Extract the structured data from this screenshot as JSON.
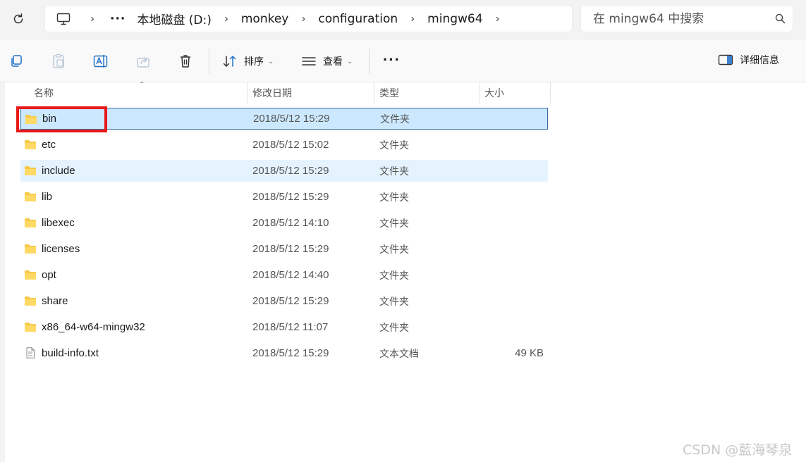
{
  "address_bar": {
    "crumbs": [
      "本地磁盘 (D:)",
      "monkey",
      "configuration",
      "mingw64"
    ],
    "ellipsis": "···"
  },
  "search": {
    "placeholder": "在 mingw64 中搜索"
  },
  "command_bar": {
    "sort_label": "排序",
    "view_label": "查看",
    "more_label": "···",
    "details_label": "详细信息"
  },
  "columns": {
    "name": "名称",
    "date": "修改日期",
    "type": "类型",
    "size": "大小"
  },
  "files": [
    {
      "name": "bin",
      "date": "2018/5/12 15:29",
      "type": "文件夹",
      "size": "",
      "kind": "folder"
    },
    {
      "name": "etc",
      "date": "2018/5/12 15:02",
      "type": "文件夹",
      "size": "",
      "kind": "folder"
    },
    {
      "name": "include",
      "date": "2018/5/12 15:29",
      "type": "文件夹",
      "size": "",
      "kind": "folder"
    },
    {
      "name": "lib",
      "date": "2018/5/12 15:29",
      "type": "文件夹",
      "size": "",
      "kind": "folder"
    },
    {
      "name": "libexec",
      "date": "2018/5/12 14:10",
      "type": "文件夹",
      "size": "",
      "kind": "folder"
    },
    {
      "name": "licenses",
      "date": "2018/5/12 15:29",
      "type": "文件夹",
      "size": "",
      "kind": "folder"
    },
    {
      "name": "opt",
      "date": "2018/5/12 14:40",
      "type": "文件夹",
      "size": "",
      "kind": "folder"
    },
    {
      "name": "share",
      "date": "2018/5/12 15:29",
      "type": "文件夹",
      "size": "",
      "kind": "folder"
    },
    {
      "name": "x86_64-w64-mingw32",
      "date": "2018/5/12 11:07",
      "type": "文件夹",
      "size": "",
      "kind": "folder"
    },
    {
      "name": "build-info.txt",
      "date": "2018/5/12 15:29",
      "type": "文本文档",
      "size": "49 KB",
      "kind": "text-file"
    }
  ],
  "state": {
    "selected_row": "bin",
    "hovered_row": "include"
  },
  "colors": {
    "selection_bg": "#cce8ff",
    "selection_border": "#3a6ea5",
    "hover_bg": "#e5f3ff",
    "annotation_red": "#e81818",
    "folder_yellow": "#f7c948"
  },
  "watermark": "CSDN @藍海琴泉"
}
